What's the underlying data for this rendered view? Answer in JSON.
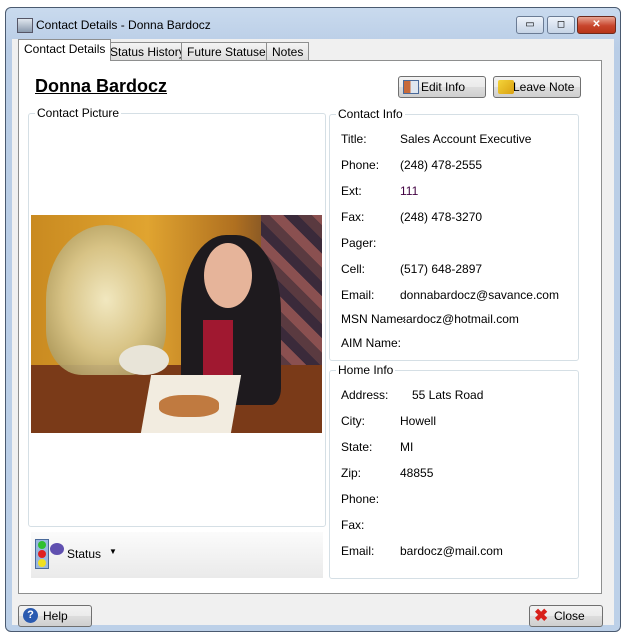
{
  "window": {
    "title": "Contact Details - Donna Bardocz",
    "minimize": "▭",
    "maximize": "◻",
    "close": "✕"
  },
  "tabs": [
    {
      "label": "Contact Details",
      "active": true
    },
    {
      "label": "Status History"
    },
    {
      "label": "Future Statuses"
    },
    {
      "label": "Notes"
    }
  ],
  "contact": {
    "name": "Donna Bardocz"
  },
  "buttons": {
    "edit_info": "Edit Info",
    "leave_note": "Leave Note",
    "help": "Help",
    "close": "Close",
    "status": "Status"
  },
  "picture_group": {
    "legend": "Contact Picture"
  },
  "contact_info": {
    "legend": "Contact Info",
    "rows": [
      {
        "label": "Title:",
        "value": "Sales Account Executive"
      },
      {
        "label": "Phone:",
        "value": "(248) 478-2555"
      },
      {
        "label": "Ext:",
        "value": "111"
      },
      {
        "label": "Fax:",
        "value": "(248) 478-3270"
      },
      {
        "label": "Pager:",
        "value": ""
      },
      {
        "label": "Cell:",
        "value": "(517) 648-2897"
      },
      {
        "label": "Email:",
        "value": "donnabardocz@savance.com"
      },
      {
        "label": "MSN Name:",
        "value": "›ardocz@hotmail.com"
      },
      {
        "label": "AIM Name:",
        "value": ""
      }
    ]
  },
  "home_info": {
    "legend": "Home Info",
    "rows": [
      {
        "label": "Address:",
        "value": "55 Lats Road"
      },
      {
        "label": "City:",
        "value": "Howell"
      },
      {
        "label": "State:",
        "value": "MI"
      },
      {
        "label": "Zip:",
        "value": "48855"
      },
      {
        "label": "Phone:",
        "value": ""
      },
      {
        "label": "Fax:",
        "value": ""
      },
      {
        "label": "Email:",
        "value": "bardocz@mail.com"
      }
    ]
  },
  "colors": {
    "ext_value": "#400040",
    "close_button": "#c8452c"
  }
}
